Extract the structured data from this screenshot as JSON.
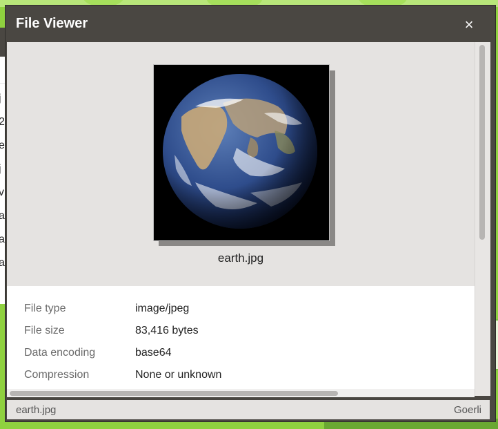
{
  "dialog": {
    "title": "File Viewer",
    "close_label": "×"
  },
  "preview": {
    "filename": "earth.jpg",
    "image_icon": "earth-image"
  },
  "info": {
    "rows": [
      {
        "label": "File type",
        "value": "image/jpeg"
      },
      {
        "label": "File size",
        "value": "83,416 bytes"
      },
      {
        "label": "Data encoding",
        "value": "base64"
      },
      {
        "label": "Compression",
        "value": "None or unknown"
      }
    ]
  },
  "status": {
    "left": "earth.jpg",
    "right": "Goerli"
  },
  "colors": {
    "titlebar": "#4a4742",
    "preview_bg": "#e5e3e1",
    "desktop": "#8fd13f"
  }
}
